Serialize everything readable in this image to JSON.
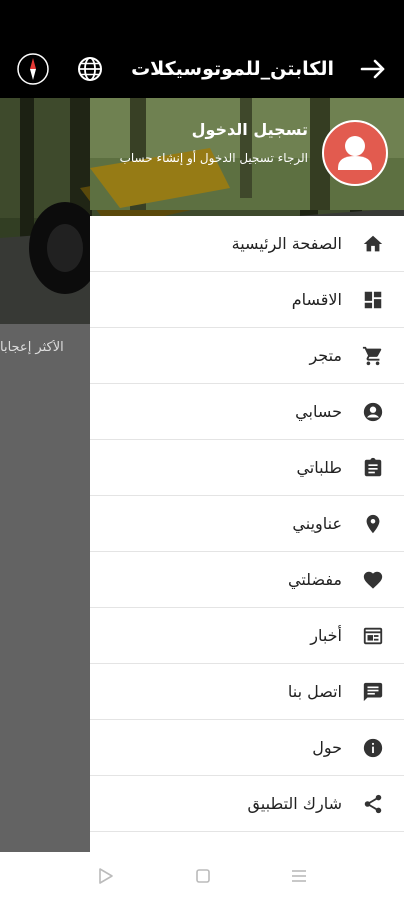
{
  "app_bar": {
    "title": "الكابتن_للموتوسيكلات",
    "back_icon": "arrow-right-icon",
    "language_icon": "globe-icon",
    "compass_icon": "compass-icon"
  },
  "background": {
    "section_label": "الأكثر إعجابا"
  },
  "drawer": {
    "login_title": "تسجيل الدخول",
    "login_subtitle": "الرجاء تسجيل الدخول أو إنشاء حساب",
    "avatar_color": "#e25b4f",
    "items": [
      {
        "label": "الصفحة الرئيسية",
        "icon": "home-icon"
      },
      {
        "label": "الاقسام",
        "icon": "dashboard-icon"
      },
      {
        "label": "متجر",
        "icon": "cart-icon"
      },
      {
        "label": "حسابي",
        "icon": "account-icon"
      },
      {
        "label": "طلباتي",
        "icon": "clipboard-icon"
      },
      {
        "label": "عناويني",
        "icon": "location-icon"
      },
      {
        "label": "مفضلتي",
        "icon": "heart-icon"
      },
      {
        "label": "أخبار",
        "icon": "news-icon"
      },
      {
        "label": "اتصل بنا",
        "icon": "chat-icon"
      },
      {
        "label": "حول",
        "icon": "info-icon"
      },
      {
        "label": "شارك التطبيق",
        "icon": "share-icon"
      }
    ]
  },
  "nav_bar": {
    "back_icon": "nav-back-icon",
    "home_icon": "nav-home-icon",
    "recents_icon": "nav-recents-icon"
  }
}
